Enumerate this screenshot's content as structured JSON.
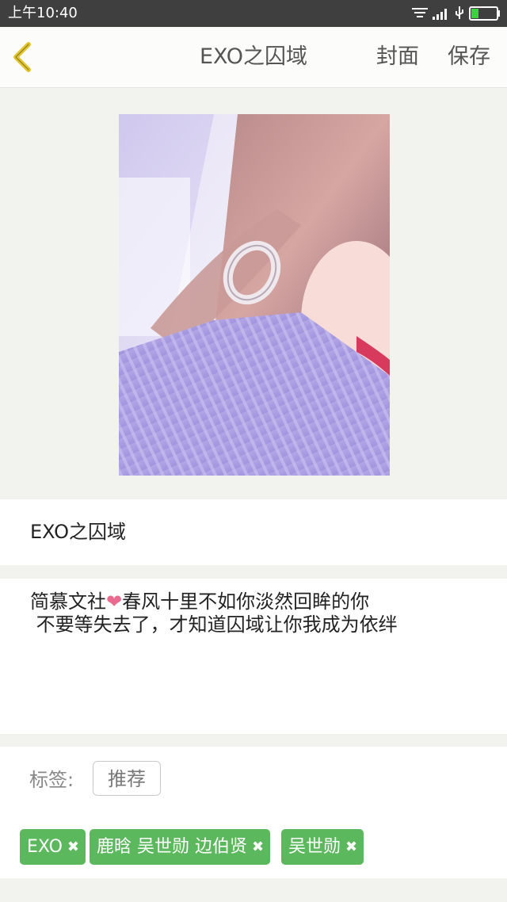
{
  "status_bar": {
    "time": "上午10:40",
    "icons": [
      "notification-icon",
      "signal-icon",
      "usb-icon",
      "battery-icon"
    ]
  },
  "nav": {
    "title": "EXO之囚域",
    "cover_label": "封面",
    "save_label": "保存"
  },
  "book": {
    "title": "EXO之囚域",
    "description_part1": "简慕文社",
    "description_heart": "❤",
    "description_part2": "春风十里不如你淡然回眸的你\n 不要等失去了，才知道囚域让你我成为依绊"
  },
  "tags": {
    "label": "标签:",
    "recommend_label": "推荐",
    "items": [
      {
        "text": "EXO"
      },
      {
        "text": "鹿晗 吴世勋 边伯贤"
      },
      {
        "text": "吴世勋"
      }
    ]
  },
  "colors": {
    "status_bar": "#3f3f3f",
    "back_chevron": "#e3c52a",
    "tag_chip": "#5cb85c",
    "heart": "#e86a8f"
  }
}
